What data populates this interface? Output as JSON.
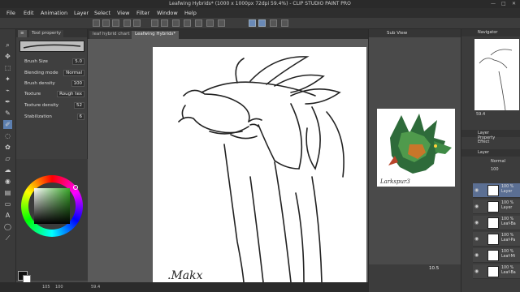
{
  "window": {
    "title": "Leafwing Hybrids* (1000 x 1000px 72dpi 59.4%) - CLIP STUDIO PAINT PRO",
    "controls": [
      "—",
      "□",
      "✕"
    ]
  },
  "menu": [
    "File",
    "Edit",
    "Animation",
    "Layer",
    "Select",
    "View",
    "Filter",
    "Window",
    "Help"
  ],
  "tool_property": {
    "tab": "Tool property",
    "brush_size": {
      "label": "Brush Size",
      "value": "5.0"
    },
    "blending_mode": {
      "label": "Blending mode",
      "value": "Normal"
    },
    "brush_density": {
      "label": "Brush density",
      "value": "100"
    },
    "texture": {
      "label": "Texture",
      "value": "Rough tex"
    },
    "texture_density": {
      "label": "Texture density",
      "value": "52"
    },
    "stabilization": {
      "label": "Stabilization",
      "value": "6"
    }
  },
  "document_tabs": [
    {
      "label": "leaf hybrid chart",
      "active": false
    },
    {
      "label": "Leafwing Hybrids*",
      "active": true
    }
  ],
  "status": {
    "zoom_left": "105",
    "zoom_right": "100",
    "canvas_zoom": "59.4"
  },
  "subview": {
    "title": "Sub View",
    "signature": "Larkspur3",
    "zoom": "10.5"
  },
  "navigator": {
    "title": "Navigator",
    "zoom": "59.4"
  },
  "layer_property": {
    "title": "Layer Property",
    "effect": "Effect"
  },
  "layer_panel": {
    "title": "Layer",
    "blend": "Normal",
    "opacity": "100"
  },
  "layers": [
    {
      "line1": "100 %",
      "line2": "Layer",
      "active": true
    },
    {
      "line1": "100 %",
      "line2": "Layer",
      "active": false
    },
    {
      "line1": "100 %",
      "line2": "Leaf-Ba",
      "active": false
    },
    {
      "line1": "100 %",
      "line2": "Leaf-Pa",
      "active": false
    },
    {
      "line1": "100 %",
      "line2": "Leaf-Mi",
      "active": false
    },
    {
      "line1": "100 %",
      "line2": "Leaf-Ba",
      "active": false
    }
  ],
  "colors": {
    "accent": "#5c7fb0",
    "main_color": "#111111",
    "sub_color": "#ffffff",
    "picker_hue": "#3aa82a"
  },
  "icons": [
    "pencil-icon",
    "brush-icon",
    "eraser-icon",
    "fill-icon",
    "select-icon",
    "move-icon",
    "eyedropper-icon",
    "text-icon",
    "undo-icon",
    "redo-icon",
    "eye-icon"
  ]
}
